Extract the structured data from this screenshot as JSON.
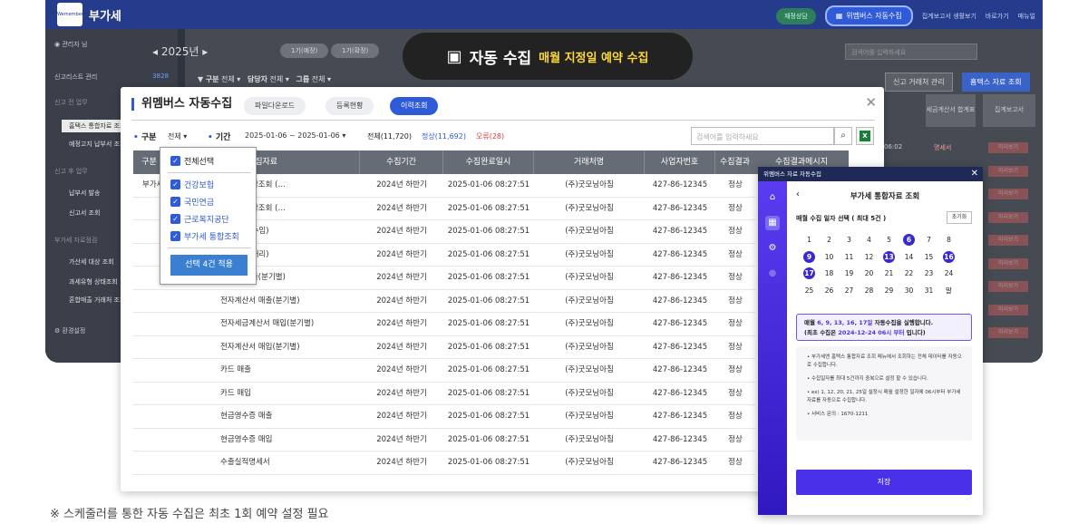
{
  "app": {
    "title": "부가세",
    "logo_text": "Wemembers",
    "user": "관리자 님",
    "top_links": [
      "재정상담",
      "위멤버스 자동수집",
      "집계보고서 생활보기",
      "바로가기",
      "매뉴얼"
    ]
  },
  "sidebar": {
    "items": [
      {
        "label": "신고리스트 관리",
        "badge": "3828"
      },
      {
        "label": "신고 전 업무"
      },
      {
        "label": "홈택스 통합자료 조회"
      },
      {
        "label": "예정고지 납부서 조회"
      },
      {
        "label": "신고 후 업무"
      },
      {
        "label": "납부서 발송"
      },
      {
        "label": "신고서 조회"
      },
      {
        "label": "부가세 자료점검"
      },
      {
        "label": "가산세 대상 조회"
      },
      {
        "label": "과세유형 상태조회"
      },
      {
        "label": "혼합매출 거래처 조회"
      },
      {
        "label": "환경설정"
      }
    ]
  },
  "background": {
    "year": "2025년",
    "year_pills": [
      "1기(예정)",
      "1기(확정)"
    ],
    "filters": [
      "구분",
      "전체",
      "담당자",
      "전체",
      "그룹",
      "전체"
    ],
    "search_placeholder": "검색어를 입력하세요",
    "buttons": [
      "신고 거래처 관리",
      "홈택스 자료 조회"
    ],
    "columns": [
      "세금계산서 합계표",
      "집계보고서"
    ],
    "row_time": "06:02",
    "row_link": "명세서",
    "preview_label": "미리보기"
  },
  "toast": {
    "main": "자동 수집",
    "sub": "매월 지정일 예약 수집"
  },
  "modal": {
    "title": "위멤버스 자동수집",
    "tabs": [
      "파일다운로드",
      "등록현황",
      "이력조회"
    ],
    "filter": {
      "type_label": "구분",
      "type_value": "전체",
      "period_label": "기간",
      "period_value": "2025-01-06 ~ 2025-01-06",
      "total": "전체(11,720)",
      "normal": "정상(11,692)",
      "error": "오류(28)"
    },
    "search_placeholder": "검색어를 입력하세요",
    "columns": [
      "구분",
      "수집자료",
      "수집기간",
      "수집완료일시",
      "거래처명",
      "사업자번호",
      "수집결과",
      "수집결과메시지"
    ],
    "rows": [
      {
        "type": "부가세",
        "data": "고자료 통합조회 (…",
        "period": "2024년 하반기",
        "done": "2025-01-06 08:27:51",
        "client": "(주)굿모닝아침",
        "bizno": "427-86-12345",
        "result": "정상"
      },
      {
        "type": "",
        "data": "고자료 통합조회 (…",
        "period": "2024년 하반기",
        "done": "2025-01-06 08:27:51",
        "client": "(주)굿모닝아침",
        "bizno": "427-86-12345",
        "result": "정상"
      },
      {
        "type": "",
        "data": "세액(기장수임)",
        "period": "2024년 하반기",
        "done": "2025-01-06 08:27:51",
        "client": "(주)굿모닝아침",
        "bizno": "427-86-12345",
        "result": "정상"
      },
      {
        "type": "",
        "data": "세액(신고대리)",
        "period": "2024년 하반기",
        "done": "2025-01-06 08:27:51",
        "client": "(주)굿모닝아침",
        "bizno": "427-86-12345",
        "result": "정상"
      },
      {
        "type": "",
        "data": "계산서 매출(분기별)",
        "period": "2024년 하반기",
        "done": "2025-01-06 08:27:51",
        "client": "(주)굿모닝아침",
        "bizno": "427-86-12345",
        "result": "정상"
      },
      {
        "type": "",
        "data": "전자계산서 매출(분기별)",
        "period": "2024년 하반기",
        "done": "2025-01-06 08:27:51",
        "client": "(주)굿모닝아침",
        "bizno": "427-86-12345",
        "result": "정상"
      },
      {
        "type": "",
        "data": "전자세금계산서 매입(분기별)",
        "period": "2024년 하반기",
        "done": "2025-01-06 08:27:51",
        "client": "(주)굿모닝아침",
        "bizno": "427-86-12345",
        "result": "정상"
      },
      {
        "type": "",
        "data": "전자계산서 매입(분기별)",
        "period": "2024년 하반기",
        "done": "2025-01-06 08:27:51",
        "client": "(주)굿모닝아침",
        "bizno": "427-86-12345",
        "result": "정상"
      },
      {
        "type": "",
        "data": "카드 매출",
        "period": "2024년 하반기",
        "done": "2025-01-06 08:27:51",
        "client": "(주)굿모닝아침",
        "bizno": "427-86-12345",
        "result": "정상"
      },
      {
        "type": "",
        "data": "카드 매입",
        "period": "2024년 하반기",
        "done": "2025-01-06 08:27:51",
        "client": "(주)굿모닝아침",
        "bizno": "427-86-12345",
        "result": "정상"
      },
      {
        "type": "",
        "data": "현금영수증 매출",
        "period": "2024년 하반기",
        "done": "2025-01-06 08:27:51",
        "client": "(주)굿모닝아침",
        "bizno": "427-86-12345",
        "result": "정상"
      },
      {
        "type": "",
        "data": "현금영수증 매입",
        "period": "2024년 하반기",
        "done": "2025-01-06 08:27:51",
        "client": "(주)굿모닝아침",
        "bizno": "427-86-12345",
        "result": "정상"
      },
      {
        "type": "",
        "data": "수출실적명세서",
        "period": "2024년 하반기",
        "done": "2025-01-06 08:27:51",
        "client": "(주)굿모닝아침",
        "bizno": "427-86-12345",
        "result": "정상"
      }
    ]
  },
  "dropdown": {
    "select_all": "전체선택",
    "options": [
      "건강보험",
      "국민연금",
      "근로복지공단",
      "부가세 통합조회"
    ],
    "apply": "선택 4건 적용"
  },
  "panel": {
    "window_title": "위멤버스 자료 자동수집",
    "title": "부가세 통합자료 조회",
    "subtitle": "매월 수집 일자 선택 ( 최대 5건 )",
    "reset": "초기화",
    "days": [
      "1",
      "2",
      "3",
      "4",
      "5",
      "6",
      "7",
      "8",
      "9",
      "10",
      "11",
      "12",
      "13",
      "14",
      "15",
      "16",
      "17",
      "18",
      "19",
      "20",
      "21",
      "22",
      "23",
      "24",
      "25",
      "26",
      "27",
      "28",
      "29",
      "30",
      "31",
      "말"
    ],
    "selected_days": [
      "6",
      "9",
      "13",
      "16",
      "17"
    ],
    "info_line1_pre": "매월 ",
    "info_line1_days": "6, 9, 13, 16, 17일",
    "info_line1_post": " 자동수집을 실행합니다.",
    "info_line2_pre": "(최초 수집은 ",
    "info_line2_date": "2024-12-24 06시 부터",
    "info_line2_post": " 입니다)",
    "notes": [
      "• 부가세엔 홈택스 통합자료 조회 메뉴에서 조회하는 전체 데이터를 자동으로 수집합니다.",
      "• 수집일자를 최대 5건까지 중복으로 설정 할 수 있습니다.",
      "• ex) 1, 12, 20, 21, 25일 설정시 매월 설정한 일자에 06시부터 부가세 자료를 자동으로 수집합니다.",
      "• 서비스 문의 : 1670-1211"
    ],
    "save": "저장"
  },
  "footnote": "※ 스케줄러를 통한 자동 수집은 최초 1회 예약 설정 필요"
}
